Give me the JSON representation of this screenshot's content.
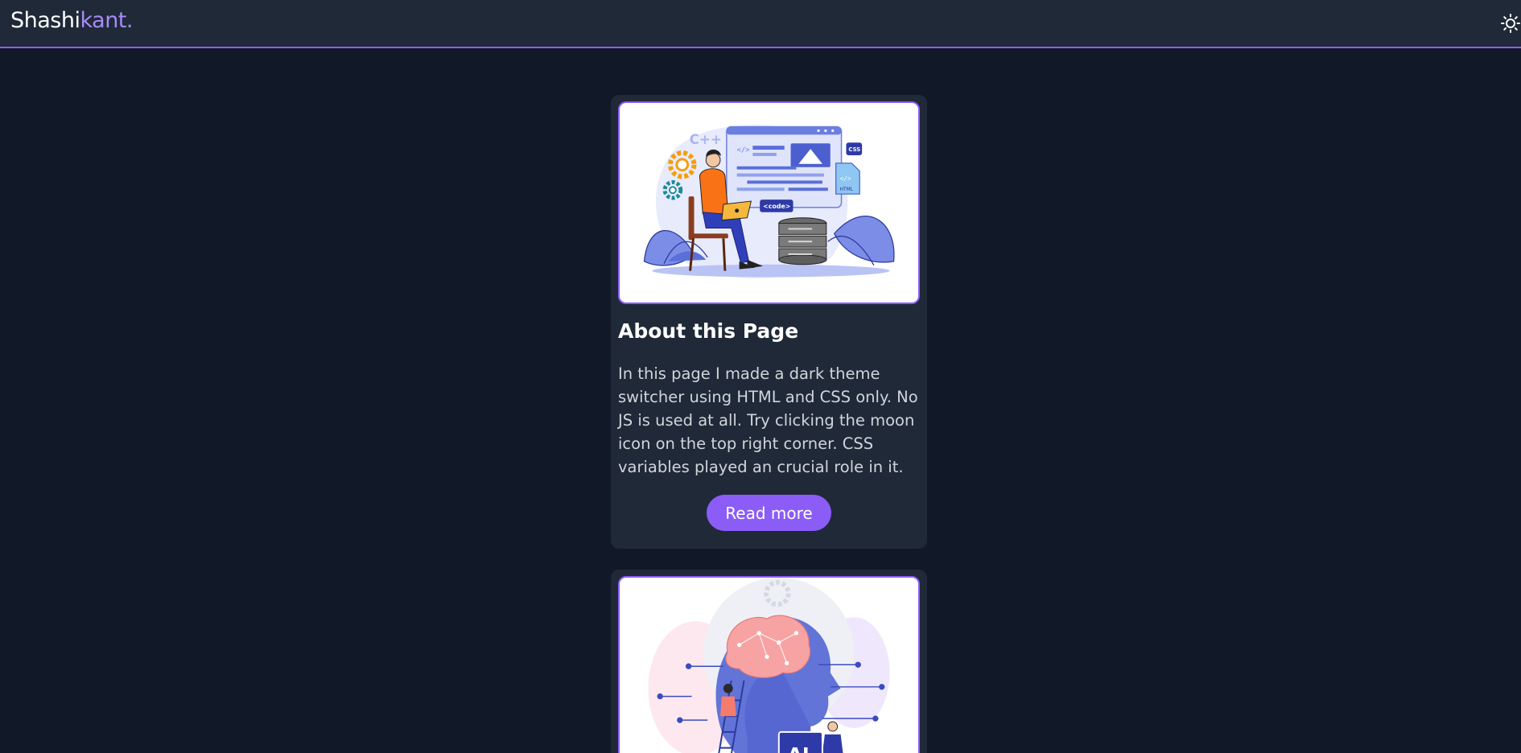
{
  "header": {
    "logo_part1": "Shashi",
    "logo_part2": "kant.",
    "theme_toggle_icon": "sun-icon"
  },
  "colors": {
    "accent": "#8b5cf6",
    "background": "#111827",
    "surface": "#1f2937"
  },
  "cards": [
    {
      "image_icon": "web-developer-illustration",
      "image_labels": [
        "C++",
        "CSS",
        "HTML",
        "<code>",
        "</>"
      ],
      "title": "About this Page",
      "text": "In this page I made a dark theme switcher using HTML and CSS only. No JS is used at all. Try clicking the moon icon on the top right corner. CSS variables played an crucial role in it.",
      "button_label": "Read more"
    },
    {
      "image_icon": "ai-brain-illustration",
      "image_labels": [
        "AI"
      ]
    }
  ]
}
